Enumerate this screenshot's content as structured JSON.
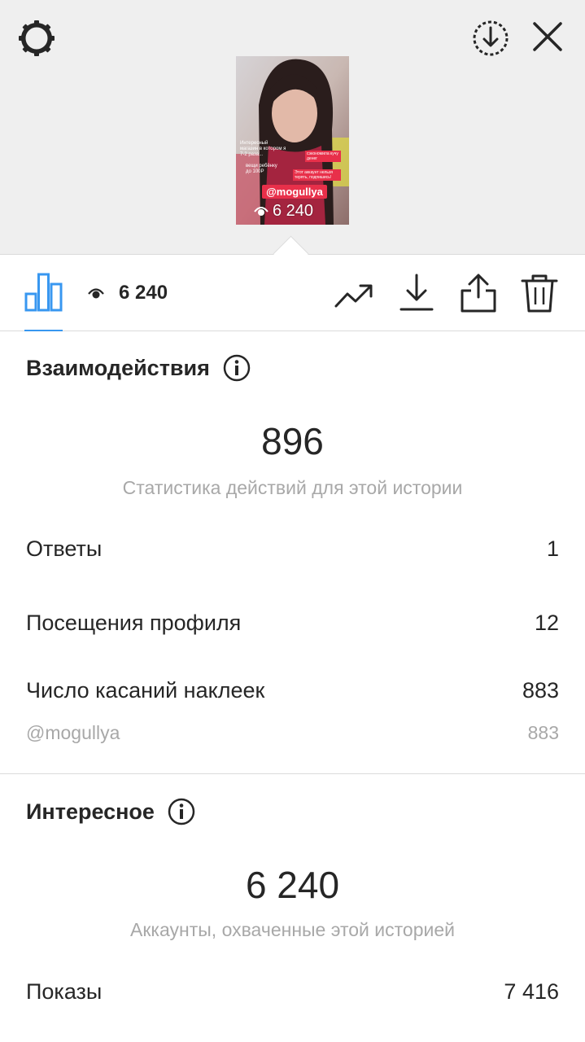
{
  "top_bar": {
    "settings_icon": "gear-icon",
    "download_icon": "download-circle-icon",
    "close_icon": "close-icon"
  },
  "preview": {
    "sticker": "@mogullya",
    "views": "6 240",
    "overlay_text_1": "Интересный магазин в котором я 7-2 раза...",
    "overlay_text_2": "сэкономила кучу денег",
    "overlay_text_3": "вещи ребёнку до 100Р",
    "overlay_text_4": "Этот аккаунт нельзя терять, подпишись!"
  },
  "toolbar": {
    "insights_icon": "bar-chart-icon",
    "views_icon": "eye-icon",
    "views_count": "6 240",
    "trend_icon": "trend-up-icon",
    "save_icon": "download-arrow-icon",
    "share_icon": "share-icon",
    "delete_icon": "trash-icon",
    "accent_color": "#3897f0"
  },
  "interactions": {
    "title": "Взаимодействия",
    "info_icon": "info-icon",
    "total": "896",
    "caption": "Статистика действий для этой истории",
    "rows": [
      {
        "label": "Ответы",
        "value": "1"
      },
      {
        "label": "Посещения профиля",
        "value": "12"
      },
      {
        "label": "Число касаний наклеек",
        "value": "883"
      }
    ],
    "sub_row": {
      "label": "@mogullya",
      "value": "883"
    }
  },
  "discovery": {
    "title": "Интересное",
    "info_icon": "info-icon",
    "total": "6 240",
    "caption": "Аккаунты, охваченные этой историей",
    "rows": [
      {
        "label": "Показы",
        "value": "7 416"
      }
    ]
  }
}
